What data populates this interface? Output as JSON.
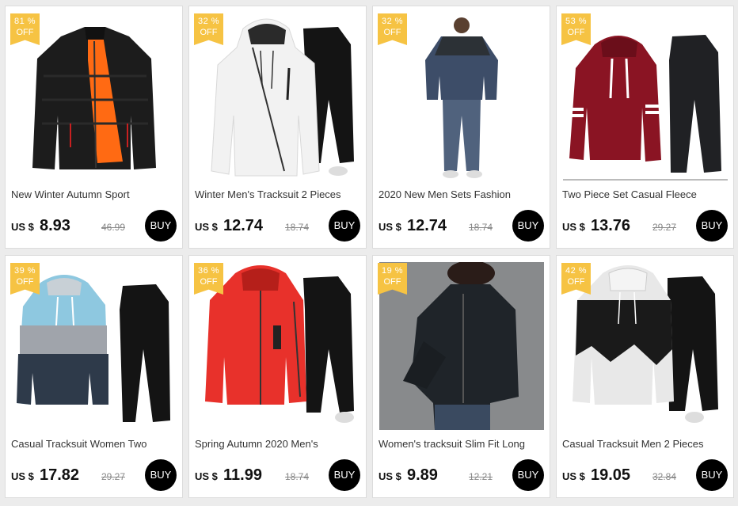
{
  "currency_label": "US $",
  "buy_label": "BUY",
  "off_label": "OFF",
  "products": [
    {
      "discount": "81 %",
      "title": "New Winter Autumn Sport",
      "price": "8.93",
      "old_price": "46.99",
      "image": "black-puffer-jacket"
    },
    {
      "discount": "32 %",
      "title": "Winter Men's Tracksuit 2 Pieces",
      "price": "12.74",
      "old_price": "18.74",
      "image": "white-hoodie-black-pants"
    },
    {
      "discount": "32 %",
      "title": "2020 New Men Sets Fashion",
      "price": "12.74",
      "old_price": "18.74",
      "image": "camo-tracksuit-model"
    },
    {
      "discount": "53 %",
      "title": "Two Piece Set Casual Fleece",
      "price": "13.76",
      "old_price": "29.27",
      "image": "red-hoodie-black-pants"
    },
    {
      "discount": "39 %",
      "title": "Casual Tracksuit Women Two",
      "price": "17.82",
      "old_price": "29.27",
      "image": "colorblock-hoodie-black-pants"
    },
    {
      "discount": "36 %",
      "title": "Spring Autumn 2020 Men's",
      "price": "11.99",
      "old_price": "18.74",
      "image": "red-zip-hoodie-black-pants"
    },
    {
      "discount": "19 %",
      "title": "Women's tracksuit Slim Fit Long",
      "price": "9.89",
      "old_price": "12.21",
      "image": "black-sport-jacket-model"
    },
    {
      "discount": "42 %",
      "title": "Casual Tracksuit Men 2 Pieces",
      "price": "19.05",
      "old_price": "32.84",
      "image": "ink-print-hoodie-black-pants"
    }
  ],
  "colors": {
    "badge": "#f6c343",
    "buy_button": "#000000",
    "card_bg": "#ffffff",
    "page_bg": "#ececec"
  }
}
